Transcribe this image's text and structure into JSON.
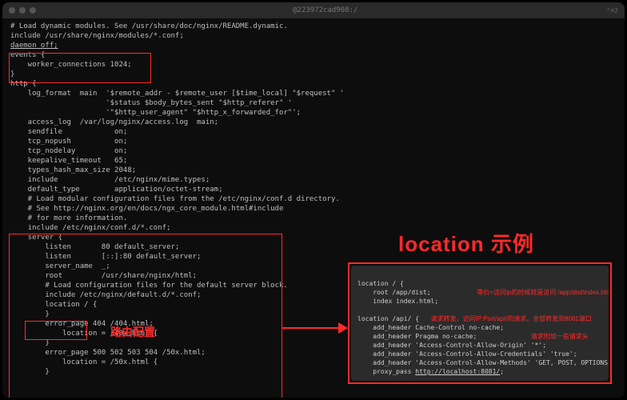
{
  "titlebar": {
    "center": "@223972cad908:/",
    "right": "⌃⌘2"
  },
  "code": {
    "lines": [
      "# Load dynamic modules. See /usr/share/doc/nginx/README.dynamic.",
      "include /usr/share/nginx/modules/*.conf;",
      "daemon off;",
      "events {",
      "    worker_connections 1024;",
      "}",
      "",
      "http {",
      "    log_format  main  '$remote_addr - $remote_user [$time_local] \"$request\" '",
      "                      '$status $body_bytes_sent \"$http_referer\" '",
      "                      '\"$http_user_agent\" \"$http_x_forwarded_for\"';",
      "",
      "    access_log  /var/log/nginx/access.log  main;",
      "",
      "    sendfile            on;",
      "    tcp_nopush          on;",
      "    tcp_nodelay         on;",
      "    keepalive_timeout   65;",
      "    types_hash_max_size 2048;",
      "",
      "    include             /etc/nginx/mime.types;",
      "    default_type        application/octet-stream;",
      "",
      "    # Load modular configuration files from the /etc/nginx/conf.d directory.",
      "    # See http://nginx.org/en/docs/ngx_core_module.html#include",
      "    # for more information.",
      "    include /etc/nginx/conf.d/*.conf;",
      "",
      "    server {",
      "        listen       80 default_server;",
      "        listen       [::]:80 default_server;",
      "        server_name  _;",
      "        root         /usr/share/nginx/html;",
      "",
      "        # Load configuration files for the default server block.",
      "        include /etc/nginx/default.d/*.conf;",
      "",
      "        location / {",
      "        }",
      "",
      "        error_page 404 /404.html;",
      "            location = /40x.html {",
      "        }",
      "",
      "        error_page 500 502 503 504 /50x.html;",
      "            location = /50x.html {",
      "        }"
    ]
  },
  "annotations": {
    "title": "location 示例",
    "route": "路由配置"
  },
  "example": {
    "line1_a": "location / {",
    "line1_b": "",
    "line2": "    root /app/dist;",
    "line2_ann": "等价=访问ip的时候就是访问 /app/dist/index.html",
    "line3": "    index index.html;",
    "line4": "",
    "line5_a": "location /api/ {",
    "line5_ann": "请求转发，访问IP:Port/api/的请求，全部转发到8081端口",
    "line6": "    add_header Cache-Control no-cache;",
    "line7": "    add_header Pragma no-cache;",
    "line7_ann": "请求附加一些请求头",
    "line8": "    add_header 'Access-Control-Allow-Origin' '*';",
    "line9": "    add_header 'Access-Control-Allow-Credentials' 'true';",
    "line10": "    add_header 'Access-Control-Allow-Methods' 'GET, POST, OPTIONS, PUT, DELETE';",
    "line11_a": "    proxy_pass ",
    "line11_b": "http://localhost:8081/",
    "line11_c": ";"
  }
}
